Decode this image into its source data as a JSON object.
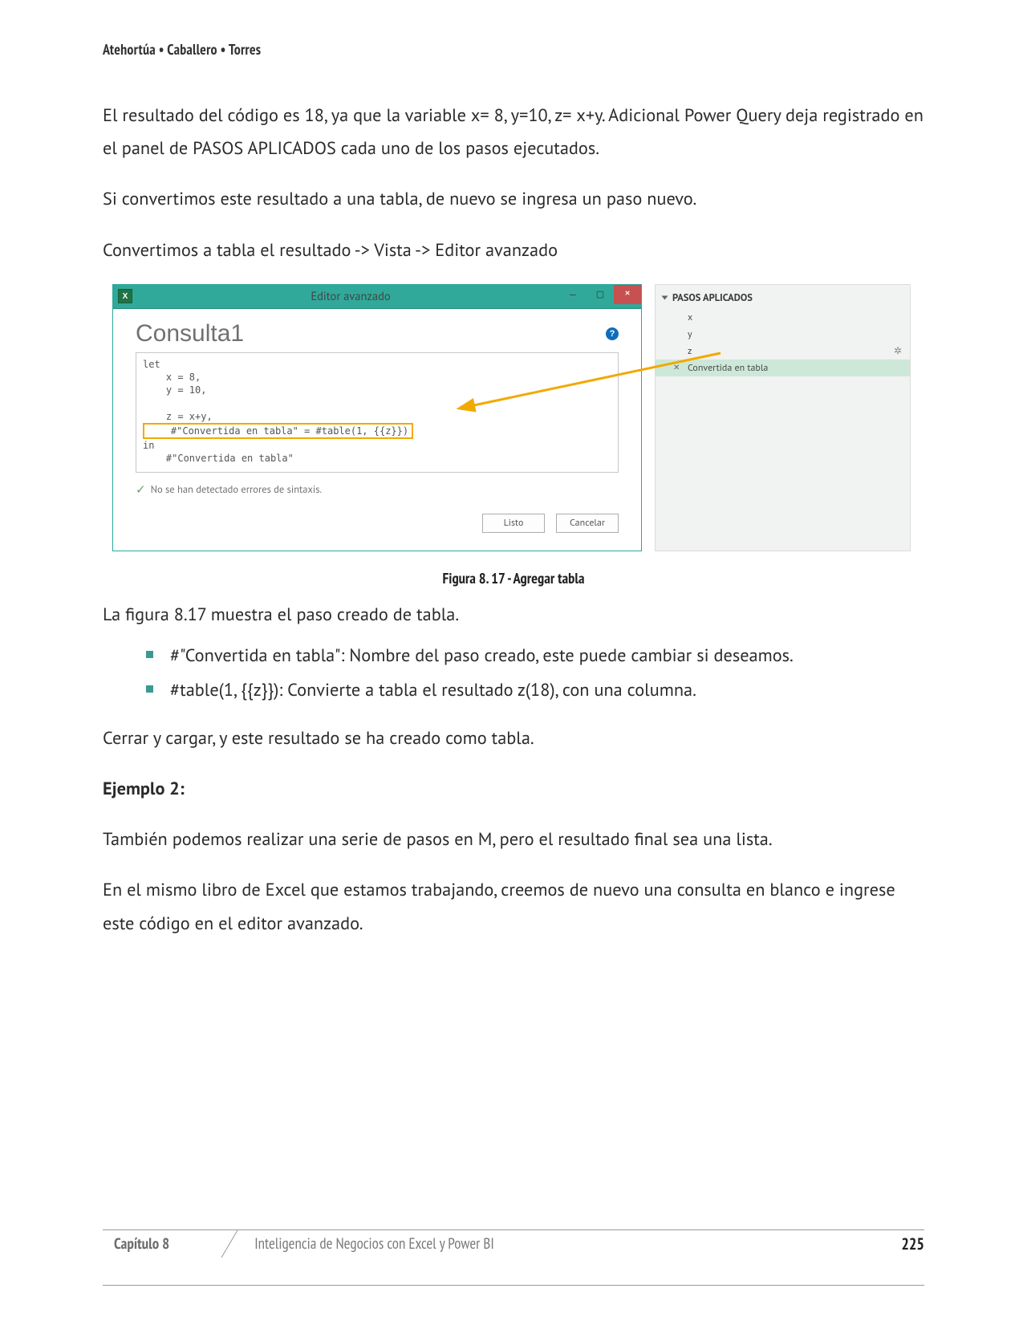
{
  "header": {
    "authors": "Atehortúa • Caballero • Torres"
  },
  "paragraphs": {
    "p1": "El resultado del código es 18, ya que la variable x= 8, y=10, z= x+y. Adicional Power Query deja registrado en el panel de PASOS APLICADOS cada uno de los pasos ejecutados.",
    "p2": "Si convertimos este resultado a una tabla, de nuevo se ingresa un paso nuevo.",
    "p3": "Convertimos a tabla el resultado -> Vista -> Editor avanzado",
    "caption": "Figura 8. 17 - Agregar tabla",
    "p4": "La figura 8.17 muestra el paso creado de tabla.",
    "li1": "#\"Convertida en tabla\":  Nombre del paso creado, este puede cambiar si deseamos.",
    "li2": "#table(1, {{z}}): Convierte a tabla el resultado z(18), con una columna.",
    "p5": "Cerrar y cargar, y este resultado se ha creado como tabla.",
    "h_ej2": "Ejemplo 2:",
    "p6": "También podemos realizar una serie de pasos en M, pero el resultado final sea una lista.",
    "p7": "En el mismo libro de Excel que estamos trabajando, creemos de nuevo una consulta en blanco e ingrese este código en el editor avanzado."
  },
  "editor": {
    "title": "Editor avanzado",
    "excel_abbr": "X",
    "query_name": "Consulta1",
    "help": "?",
    "code_pre": "let\n    x = 8,\n    y = 10,\n\n    z = x+y,",
    "code_hl": "    #\"Convertida en tabla\" = #table(1, {{z}})",
    "code_post": "in\n    #\"Convertida en tabla\"",
    "syntax_ok": "No se han detectado errores de sintaxis.",
    "btn_done": "Listo",
    "btn_cancel": "Cancelar"
  },
  "steps": {
    "header": "PASOS APLICADOS",
    "items": [
      "x",
      "y",
      "z",
      "Convertida en tabla"
    ],
    "selected_index": 3
  },
  "footer": {
    "chapter": "Capítulo 8",
    "book_title": "Inteligencia de Negocios con Excel y Power BI",
    "page": "225"
  }
}
